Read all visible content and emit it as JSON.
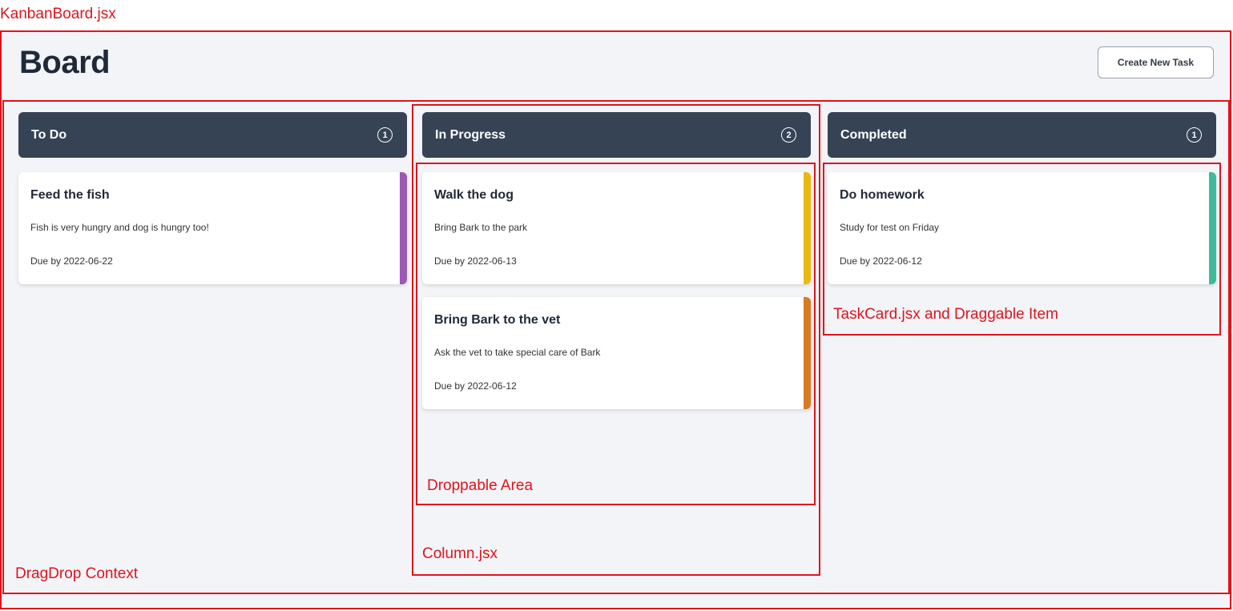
{
  "board": {
    "title": "Board",
    "create_button_label": "Create New Task"
  },
  "columns": [
    {
      "title": "To Do",
      "count": "1",
      "tasks": [
        {
          "title": "Feed the fish",
          "description": "Fish is very hungry and dog is hungry too!",
          "due": "Due by 2022-06-22",
          "accent": "#9b59b6"
        }
      ]
    },
    {
      "title": "In Progress",
      "count": "2",
      "tasks": [
        {
          "title": "Walk the dog",
          "description": "Bring Bark to the park",
          "due": "Due by 2022-06-13",
          "accent": "#e8b90f"
        },
        {
          "title": "Bring Bark to the vet",
          "description": "Ask the vet to take special care of Bark",
          "due": "Due by 2022-06-12",
          "accent": "#d67a23"
        }
      ]
    },
    {
      "title": "Completed",
      "count": "1",
      "tasks": [
        {
          "title": "Do homework",
          "description": "Study for test on Friday",
          "due": "Due by 2022-06-12",
          "accent": "#3dbb9a"
        }
      ]
    }
  ],
  "annotations": {
    "kanban_board": "KanbanBoard.jsx",
    "dragdrop_context": "DragDrop Context",
    "column": "Column.jsx",
    "droppable_area": "Droppable Area",
    "taskcard": "TaskCard.jsx and Draggable Item"
  },
  "colors": {
    "annotation": "#e0141c",
    "column_header": "#354355",
    "board_background": "#f3f4f8"
  }
}
